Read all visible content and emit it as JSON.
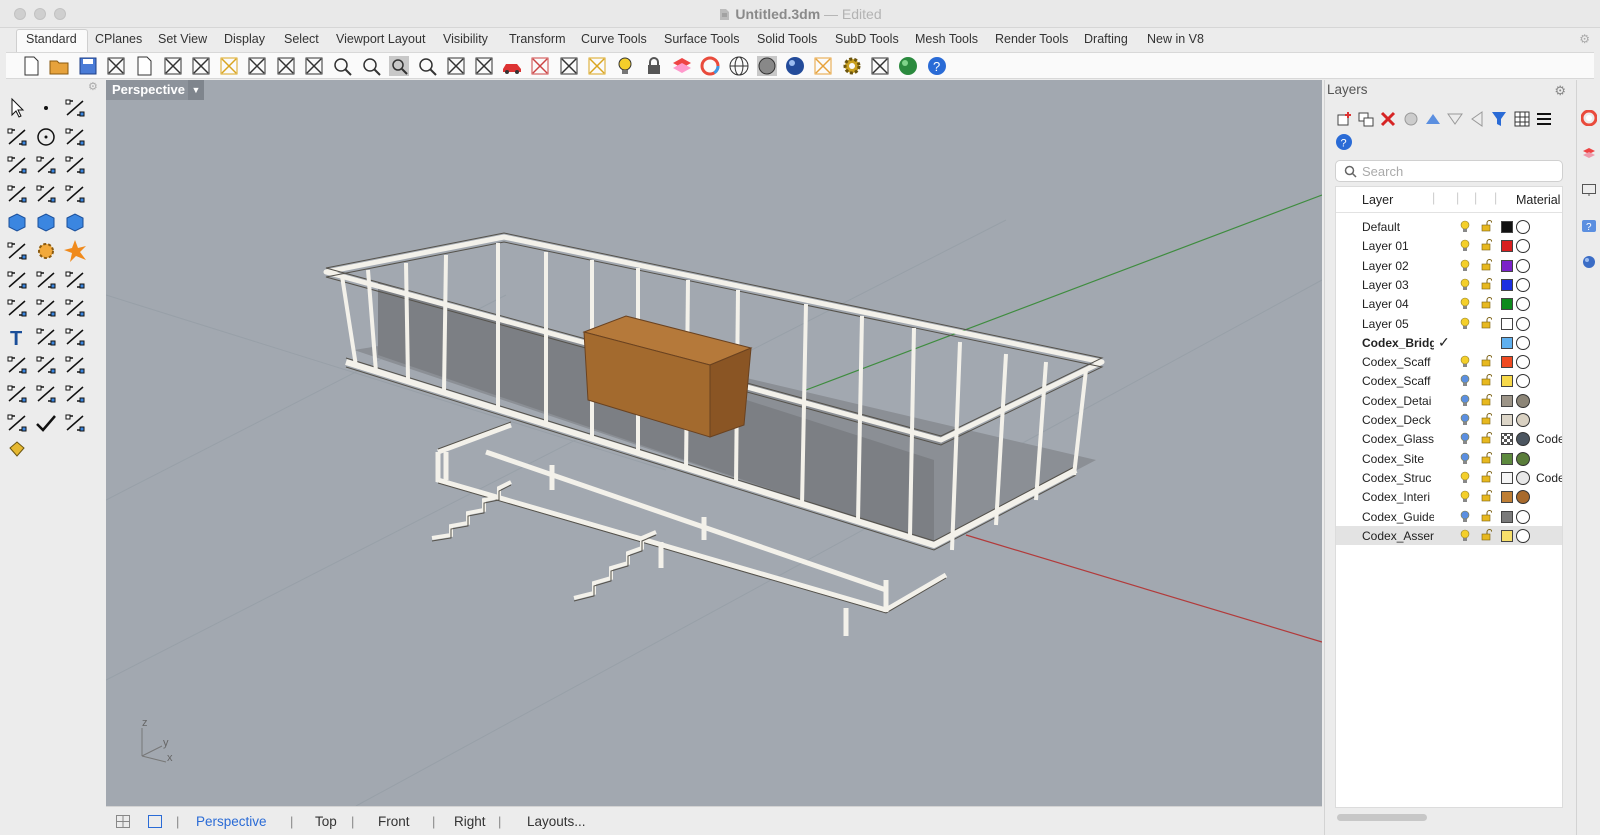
{
  "window": {
    "title": "Untitled.3dm",
    "separator": "—",
    "state": "Edited"
  },
  "tabs": [
    "Standard",
    "CPlanes",
    "Set View",
    "Display",
    "Select",
    "Viewport Layout",
    "Visibility",
    "Transform",
    "Curve Tools",
    "Surface Tools",
    "Solid Tools",
    "SubD Tools",
    "Mesh Tools",
    "Render Tools",
    "Drafting",
    "New in V8"
  ],
  "toolbar_icons": [
    "new-icon",
    "open-icon",
    "save-icon",
    "print-icon",
    "import-icon",
    "cut-icon",
    "copy-icon",
    "paste-icon",
    "undo-icon",
    "pan-hand-icon",
    "rotate-view-icon",
    "zoom-icon",
    "zoom-window-icon",
    "zoom-extents-icon",
    "zoom-selected-icon",
    "undo-view-icon",
    "four-views-icon",
    "car-icon",
    "grid-icon",
    "cplane-icon",
    "osnap-icon",
    "light-icon",
    "lock-icon",
    "layer-icon",
    "color-wheel-icon",
    "wireframe-sphere-icon",
    "shaded-sphere-icon",
    "rendered-sphere-icon",
    "pen-icon",
    "gear-icon",
    "history-icon",
    "globe-icon",
    "help-icon"
  ],
  "left_tools": [
    "select-arrow-icon",
    "point-icon",
    "polyline-icon",
    "curve-icon",
    "circle-icon",
    "ellipse-icon",
    "polygon-icon",
    "rectangle-icon",
    "polygon-shape-icon",
    "arc-icon",
    "surface-patch-icon",
    "loft-icon",
    "box-solid-icon",
    "sphere-solid-icon",
    "cylinder-solid-icon",
    "surface-plane-icon",
    "gear-puzzle-icon",
    "explode-icon",
    "trim-icon",
    "split-icon",
    "boolean-icon",
    "group-icon",
    "fillet-icon",
    "blend-icon",
    "text-icon",
    "scale-icon",
    "array-icon",
    "dimension-icon",
    "block-icon",
    "project-icon",
    "grid-array-icon",
    "align-icon",
    "sweep-icon",
    "transform-icon",
    "check-icon",
    "analyze-icon",
    "paint-bucket-icon"
  ],
  "viewport": {
    "title": "Perspective",
    "axes": {
      "z": "z",
      "y": "y",
      "x": "x"
    }
  },
  "viewport_tabs": {
    "perspective": "Perspective",
    "top": "Top",
    "front": "Front",
    "right": "Right",
    "layouts": "Layouts..."
  },
  "layers_panel": {
    "title": "Layers",
    "search_placeholder": "Search",
    "columns": {
      "layer": "Layer",
      "material": "Material"
    },
    "rows": [
      {
        "name": "Default",
        "bulb": "yellow",
        "color": "#111111",
        "mat": "#ffffff",
        "matname": ""
      },
      {
        "name": "Layer 01",
        "bulb": "yellow",
        "color": "#d81e1e",
        "mat": "#ffffff",
        "matname": ""
      },
      {
        "name": "Layer 02",
        "bulb": "yellow",
        "color": "#7b22c9",
        "mat": "#ffffff",
        "matname": ""
      },
      {
        "name": "Layer 03",
        "bulb": "yellow",
        "color": "#1b2fe0",
        "mat": "#ffffff",
        "matname": ""
      },
      {
        "name": "Layer 04",
        "bulb": "yellow",
        "color": "#0e8a1c",
        "mat": "#ffffff",
        "matname": ""
      },
      {
        "name": "Layer 05",
        "bulb": "yellow",
        "color": "#ffffff",
        "mat": "#ffffff",
        "matname": ""
      },
      {
        "name": "Codex_Bridge",
        "current": true,
        "check": "✓",
        "bulb": "",
        "color": "#5fb0ef",
        "mat": "#ffffff",
        "matname": ""
      },
      {
        "name": "Codex_Scaff",
        "bulb": "yellow",
        "color": "#f04a21",
        "mat": "#ffffff",
        "matname": ""
      },
      {
        "name": "Codex_Scaff",
        "bulb": "blue",
        "color": "#f7d94a",
        "mat": "#ffffff",
        "matname": ""
      },
      {
        "name": "Codex_Detai",
        "bulb": "blue",
        "color": "#9d9588",
        "mat": "#8c8577",
        "matname": ""
      },
      {
        "name": "Codex_Deck",
        "bulb": "blue",
        "color": "#ddd6c8",
        "mat": "#d9d1c2",
        "matname": ""
      },
      {
        "name": "Codex_Glass",
        "bulb": "blue",
        "color": "checker",
        "mat": "#4b5560",
        "matname": "Code"
      },
      {
        "name": "Codex_Site",
        "bulb": "blue",
        "color": "#5d8a3e",
        "mat": "#5a7d3a",
        "matname": ""
      },
      {
        "name": "Codex_Struc",
        "bulb": "yellow",
        "color": "#f5f5f5",
        "mat": "#e8e8e8",
        "matname": "Code"
      },
      {
        "name": "Codex_Interi",
        "bulb": "yellow",
        "color": "#bf7f35",
        "mat": "#a86a2c",
        "matname": ""
      },
      {
        "name": "Codex_Guide",
        "bulb": "blue",
        "color": "#7a7a7a",
        "mat": "#ffffff",
        "matname": ""
      },
      {
        "name": "Codex_Asser",
        "bulb": "yellow",
        "color": "#f7df6a",
        "mat": "#ffffff",
        "matname": "",
        "selected": true
      }
    ]
  },
  "colors": {
    "viewport_bg": "#a2a8b0",
    "accent_blue": "#2a6bd6",
    "bulb_yellow": "#f4cf2a",
    "bulb_blue": "#5b8fe0",
    "lock_yellow": "#e7b81f"
  }
}
